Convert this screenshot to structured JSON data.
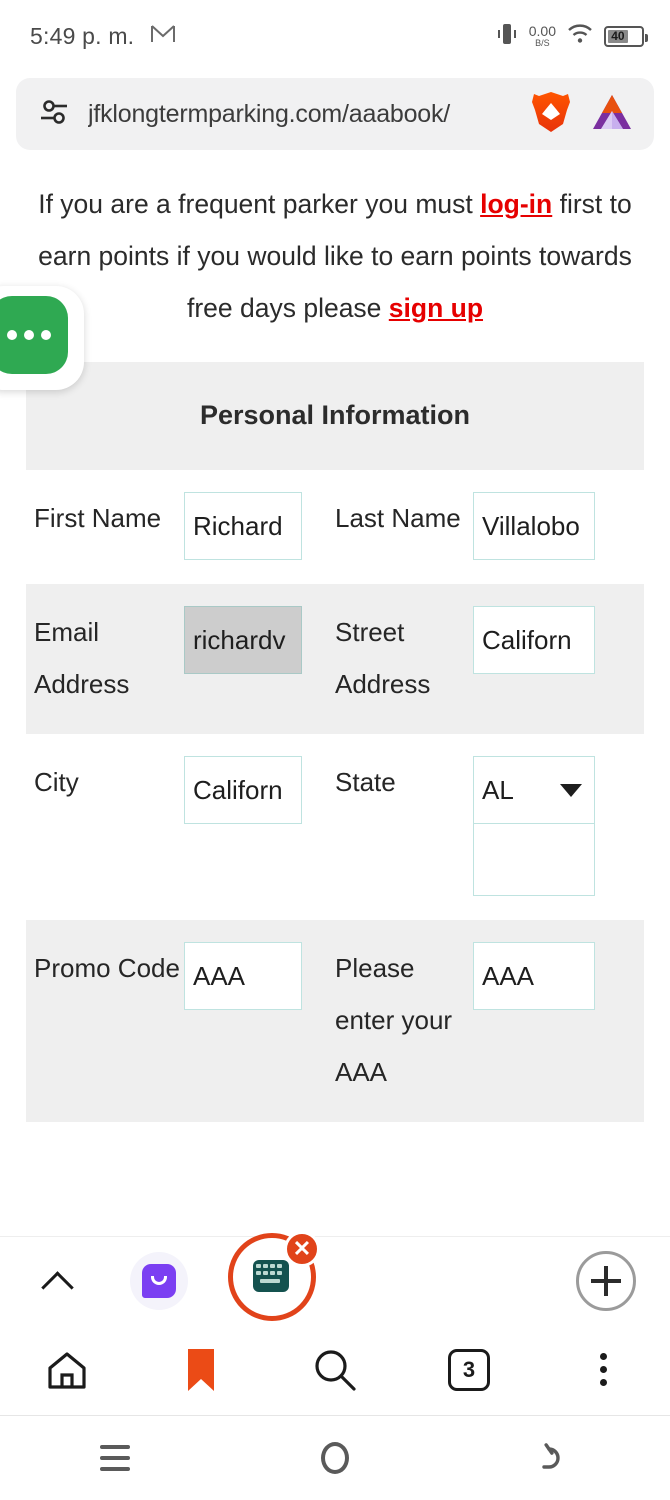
{
  "status_bar": {
    "time": "5:49 p. m.",
    "gmail_icon": "gmail-icon",
    "vibrate_icon": "vibrate-icon",
    "network_rate": "0.00",
    "network_unit": "B/S",
    "wifi_icon": "wifi-icon",
    "battery_level": "40"
  },
  "url_bar": {
    "tune_icon": "tune-icon",
    "url": "jfklongtermparking.com/aaabook/",
    "brave_icon": "brave-lion-icon",
    "bat_icon": "bat-triangle-icon"
  },
  "page": {
    "notice": {
      "line1_prefix": "If you are a frequent parker you must ",
      "login_link": "log-in",
      "line1_suffix": " first to earn points",
      "line2_prefix": "if you would like to earn points towards free days please ",
      "signup_link": "sign up",
      "link_color": "#e60000"
    },
    "section_title": "Personal Information",
    "rows": [
      {
        "left_label": "First Name",
        "left_value": "Richard",
        "right_label": "Last Name",
        "right_value": "Villalobo",
        "shaded": false
      },
      {
        "left_label": "Email Address",
        "left_value": "richardv",
        "right_label": "Street Address",
        "right_value": "Californ",
        "shaded": true
      },
      {
        "left_label": "City",
        "left_value": "Californ",
        "right_label": "State",
        "right_value": "AL",
        "shaded": false
      },
      {
        "left_label": "Promo Code",
        "left_value": "AAA",
        "right_label": "Please enter your AAA",
        "right_value": "AAA",
        "shaded": true
      }
    ]
  },
  "floating_bubble": {
    "name": "floating-chat-bubble",
    "color": "#2fa952",
    "glyph": "ellipsis"
  },
  "suggestion_bar": {
    "expand_icon": "chevron-up-icon",
    "messaging_app_icon": "messaging-app-icon",
    "keyboard_icon": "keyboard-icon",
    "keyboard_disabled_badge": "✕",
    "annotation_circle": "red-highlight-circle",
    "add_icon": "plus-icon"
  },
  "browser_toolbar": {
    "home_icon": "home-icon",
    "bookmark_icon": "bookmark-icon",
    "bookmark_color": "#eb4b16",
    "search_icon": "search-icon",
    "tab_count": "3",
    "menu_icon": "more-vertical-icon"
  },
  "nav_bar": {
    "recents_icon": "recents-icon",
    "home_icon": "home-circle-icon",
    "back_icon": "back-arrow-icon"
  }
}
